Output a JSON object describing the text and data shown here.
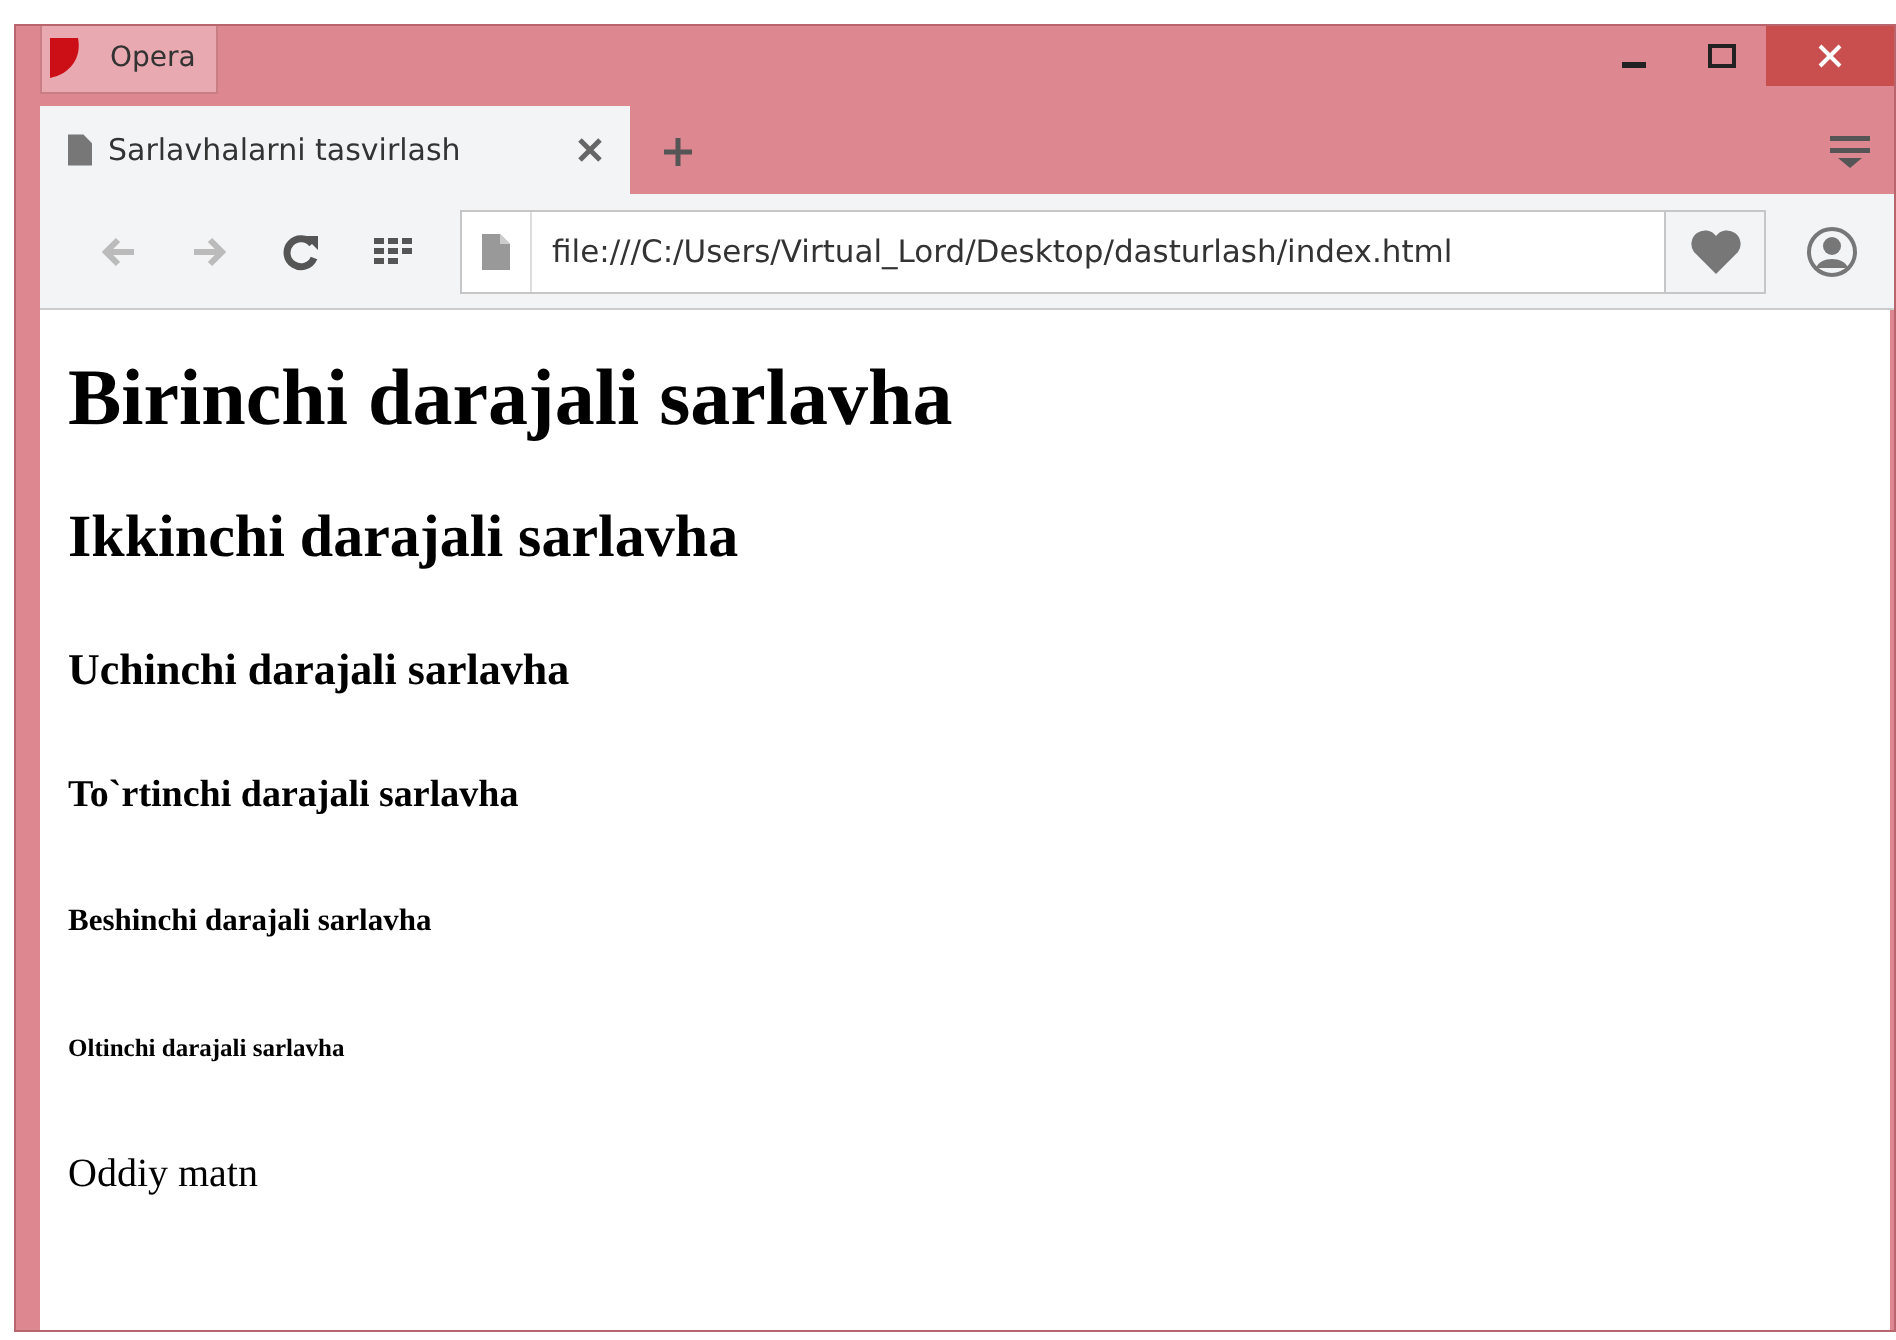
{
  "window": {
    "menu_button": "Opera"
  },
  "tabs": [
    {
      "title": "Sarlavhalarni tasvirlash",
      "selected": true
    }
  ],
  "address_bar": {
    "value": "file:///C:/Users/Virtual_Lord/Desktop/dasturlash/index.html"
  },
  "page": [
    {
      "kind": "h1",
      "text": "Birinchi darajali sarlavha"
    },
    {
      "kind": "h2",
      "text": "Ikkinchi darajali sarlavha"
    },
    {
      "kind": "h3",
      "text": "Uchinchi darajali sarlavha"
    },
    {
      "kind": "h4",
      "text": "To`rtinchi darajali sarlavha"
    },
    {
      "kind": "h5",
      "text": "Beshinchi darajali sarlavha"
    },
    {
      "kind": "h6",
      "text": "Oltinchi darajali sarlavha"
    },
    {
      "kind": "p",
      "text": "Oddiy matn"
    }
  ]
}
